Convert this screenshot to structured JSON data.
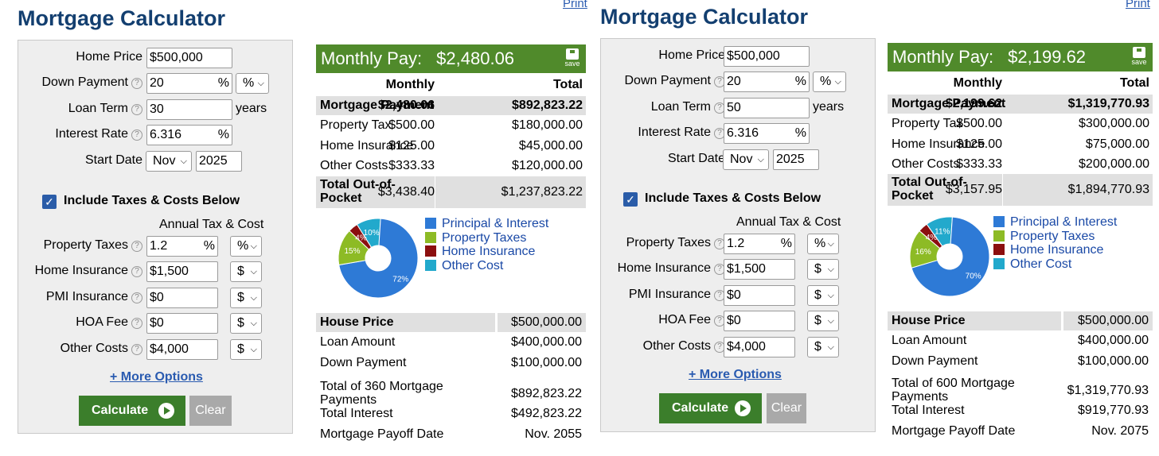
{
  "colors": {
    "title": "#133f70",
    "link": "#2a5bb0",
    "bar": "#508a2b",
    "button": "#3b7e2b",
    "checkbox": "#2a5ca8",
    "principal": "#2e7ad6",
    "taxes": "#8dbb25",
    "insurance": "#8b0f0f",
    "other": "#22a9cc"
  },
  "icons": {
    "help": "help-icon",
    "checkbox": "checkbox-checked-icon",
    "chevron": "chevron-down-icon",
    "play": "play-icon",
    "save": "save-disk-icon"
  },
  "calculators": [
    {
      "title": "Mortgage Calculator",
      "print": "Print",
      "form": {
        "home_price": {
          "label": "Home Price",
          "value": "$500,000"
        },
        "down_payment": {
          "label": "Down Payment",
          "value": "20",
          "unit": "%",
          "select": "%"
        },
        "loan_term": {
          "label": "Loan Term",
          "value": "30",
          "after": "years"
        },
        "interest_rate": {
          "label": "Interest Rate",
          "value": "6.316",
          "unit": "%"
        },
        "start_date": {
          "label": "Start Date",
          "month": "Nov",
          "year": "2025"
        },
        "include_label": "Include Taxes & Costs Below",
        "annual_label": "Annual Tax & Cost",
        "property_taxes": {
          "label": "Property Taxes",
          "value": "1.2",
          "unit": "%",
          "select": "%"
        },
        "home_insurance": {
          "label": "Home Insurance",
          "value": "$1,500",
          "select": "$"
        },
        "pmi": {
          "label": "PMI Insurance",
          "value": "$0",
          "select": "$"
        },
        "hoa": {
          "label": "HOA Fee",
          "value": "$0",
          "select": "$"
        },
        "other": {
          "label": "Other Costs",
          "value": "$4,000",
          "select": "$"
        },
        "more_options": "+ More Options",
        "calculate": "Calculate",
        "clear": "Clear"
      },
      "result": {
        "label": "Monthly Pay:",
        "amount": "$2,480.06",
        "save": "save",
        "col_monthly": "Monthly",
        "col_total": "Total",
        "rows": [
          {
            "label": "Mortgage Payment",
            "monthly": "$2,480.06",
            "total": "$892,823.22"
          },
          {
            "label": "Property Tax",
            "monthly": "$500.00",
            "total": "$180,000.00"
          },
          {
            "label": "Home Insurance",
            "monthly": "$125.00",
            "total": "$45,000.00"
          },
          {
            "label": "Other Costs",
            "monthly": "$333.33",
            "total": "$120,000.00"
          },
          {
            "label": "Total Out-of-Pocket",
            "monthly": "$3,438.40",
            "total": "$1,237,823.22"
          }
        ],
        "pie": {
          "slices": [
            72,
            15,
            4,
            10
          ],
          "labels": [
            "72%",
            "15%",
            "4%",
            "10%"
          ]
        },
        "legend": [
          "Principal & Interest",
          "Property Taxes",
          "Home Insurance",
          "Other Cost"
        ],
        "summary": [
          {
            "label": "House Price",
            "value": "$500,000.00"
          },
          {
            "label": "Loan Amount",
            "value": "$400,000.00"
          },
          {
            "label": "Down Payment",
            "value": "$100,000.00"
          },
          {
            "label": "Total of 360 Mortgage Payments",
            "value": "$892,823.22"
          },
          {
            "label": "Total Interest",
            "value": "$492,823.22"
          },
          {
            "label": "Mortgage Payoff Date",
            "value": "Nov. 2055"
          }
        ]
      }
    },
    {
      "title": "Mortgage Calculator",
      "print": "Print",
      "form": {
        "home_price": {
          "label": "Home Price",
          "value": "$500,000"
        },
        "down_payment": {
          "label": "Down Payment",
          "value": "20",
          "unit": "%",
          "select": "%"
        },
        "loan_term": {
          "label": "Loan Term",
          "value": "50",
          "after": "years"
        },
        "interest_rate": {
          "label": "Interest Rate",
          "value": "6.316",
          "unit": "%"
        },
        "start_date": {
          "label": "Start Date",
          "month": "Nov",
          "year": "2025"
        },
        "include_label": "Include Taxes & Costs Below",
        "annual_label": "Annual Tax & Cost",
        "property_taxes": {
          "label": "Property Taxes",
          "value": "1.2",
          "unit": "%",
          "select": "%"
        },
        "home_insurance": {
          "label": "Home Insurance",
          "value": "$1,500",
          "select": "$"
        },
        "pmi": {
          "label": "PMI Insurance",
          "value": "$0",
          "select": "$"
        },
        "hoa": {
          "label": "HOA Fee",
          "value": "$0",
          "select": "$"
        },
        "other": {
          "label": "Other Costs",
          "value": "$4,000",
          "select": "$"
        },
        "more_options": "+ More Options",
        "calculate": "Calculate",
        "clear": "Clear"
      },
      "result": {
        "label": "Monthly Pay:",
        "amount": "$2,199.62",
        "save": "save",
        "col_monthly": "Monthly",
        "col_total": "Total",
        "rows": [
          {
            "label": "Mortgage Payment",
            "monthly": "$2,199.62",
            "total": "$1,319,770.93"
          },
          {
            "label": "Property Tax",
            "monthly": "$500.00",
            "total": "$300,000.00"
          },
          {
            "label": "Home Insurance",
            "monthly": "$125.00",
            "total": "$75,000.00"
          },
          {
            "label": "Other Costs",
            "monthly": "$333.33",
            "total": "$200,000.00"
          },
          {
            "label": "Total Out-of-Pocket",
            "monthly": "$3,157.95",
            "total": "$1,894,770.93"
          }
        ],
        "pie": {
          "slices": [
            70,
            16,
            4,
            11
          ],
          "labels": [
            "70%",
            "16%",
            "4%",
            "11%"
          ]
        },
        "legend": [
          "Principal & Interest",
          "Property Taxes",
          "Home Insurance",
          "Other Cost"
        ],
        "summary": [
          {
            "label": "House Price",
            "value": "$500,000.00"
          },
          {
            "label": "Loan Amount",
            "value": "$400,000.00"
          },
          {
            "label": "Down Payment",
            "value": "$100,000.00"
          },
          {
            "label": "Total of 600 Mortgage Payments",
            "value": "$1,319,770.93"
          },
          {
            "label": "Total Interest",
            "value": "$919,770.93"
          },
          {
            "label": "Mortgage Payoff Date",
            "value": "Nov. 2075"
          }
        ]
      }
    }
  ]
}
